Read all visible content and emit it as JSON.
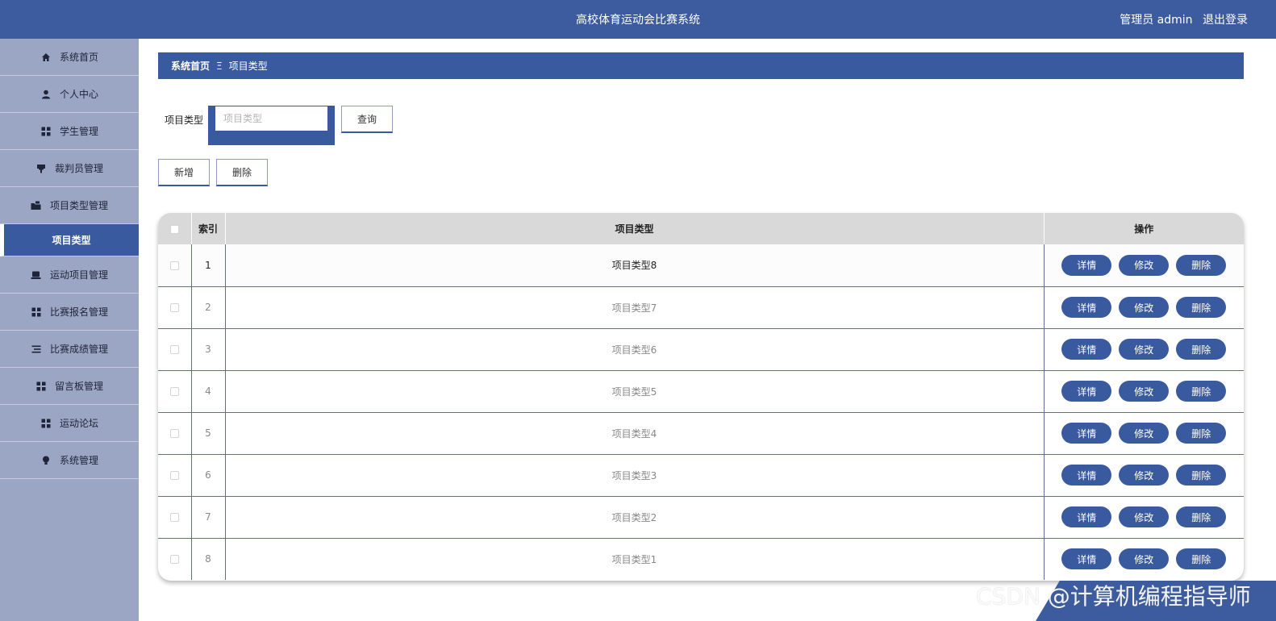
{
  "header": {
    "title": "高校体育运动会比赛系统",
    "user_role": "管理员 admin",
    "logout": "退出登录"
  },
  "sidebar": {
    "items": [
      {
        "label": "系统首页",
        "icon": "home-icon"
      },
      {
        "label": "个人中心",
        "icon": "user-icon"
      },
      {
        "label": "学生管理",
        "icon": "grid-icon"
      },
      {
        "label": "裁判员管理",
        "icon": "flag-icon"
      },
      {
        "label": "项目类型管理",
        "icon": "folder-icon"
      },
      {
        "label": "项目类型",
        "sub": true
      },
      {
        "label": "运动项目管理",
        "icon": "laptop-icon"
      },
      {
        "label": "比赛报名管理",
        "icon": "grid-icon"
      },
      {
        "label": "比赛成绩管理",
        "icon": "list-icon"
      },
      {
        "label": "留言板管理",
        "icon": "grid-icon"
      },
      {
        "label": "运动论坛",
        "icon": "grid-icon"
      },
      {
        "label": "系统管理",
        "icon": "bulb-icon"
      }
    ]
  },
  "breadcrumb": {
    "home": "系统首页",
    "separator": "Ξ",
    "current": "项目类型"
  },
  "search": {
    "label": "项目类型",
    "placeholder": "项目类型",
    "value": "",
    "query_button": "查询"
  },
  "actions": {
    "add": "新增",
    "delete": "删除"
  },
  "table": {
    "columns": [
      "索引",
      "项目类型",
      "操作"
    ],
    "rows": [
      {
        "index": "1",
        "type": "项目类型8"
      },
      {
        "index": "2",
        "type": "项目类型7"
      },
      {
        "index": "3",
        "type": "项目类型6"
      },
      {
        "index": "4",
        "type": "项目类型5"
      },
      {
        "index": "5",
        "type": "项目类型4"
      },
      {
        "index": "6",
        "type": "项目类型3"
      },
      {
        "index": "7",
        "type": "项目类型2"
      },
      {
        "index": "8",
        "type": "项目类型1"
      }
    ],
    "row_actions": {
      "detail": "详情",
      "edit": "修改",
      "delete": "删除"
    }
  },
  "watermark": "CSDN @计算机编程指导师",
  "colors": {
    "primary": "#3a5aa0",
    "header": "#3d5c9f",
    "sidebar": "#9aa6c4"
  }
}
